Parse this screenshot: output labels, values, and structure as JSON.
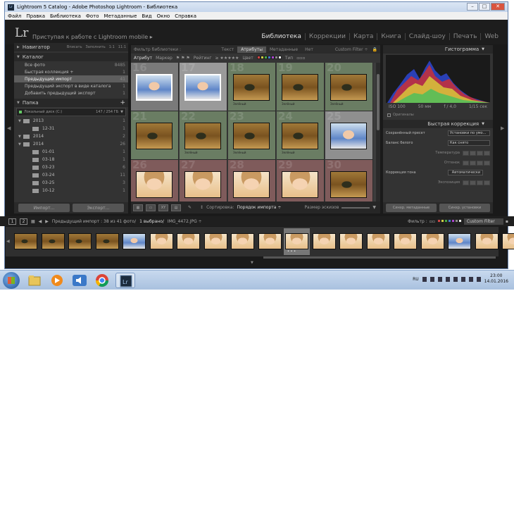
{
  "window": {
    "title": "Lightroom 5 Catalog - Adobe Photoshop Lightroom - Библиотека",
    "buttons": {
      "minimize": "–",
      "maximize": "□",
      "close": "✕"
    }
  },
  "menu": [
    "Файл",
    "Правка",
    "Библиотека",
    "Фото",
    "Метаданные",
    "Вид",
    "Окно",
    "Справка"
  ],
  "header": {
    "logo": "Lr",
    "mobile": "Приступая к работе с Lightroom mobile",
    "modules": [
      "Библиотека",
      "Коррекции",
      "Карта",
      "Книга",
      "Слайд-шоу",
      "Печать",
      "Web"
    ],
    "active_module": "Библиотека"
  },
  "left_panel": {
    "navigator": {
      "label": "Навигатор",
      "tools": [
        "Вписать",
        "Заполнить",
        "1:1",
        "11:1"
      ]
    },
    "catalog": {
      "label": "Каталог",
      "items": [
        {
          "label": "Все фото",
          "count": "8485"
        },
        {
          "label": "Быстрая коллекция +",
          "count": "1"
        },
        {
          "label": "Предыдущий импорт",
          "count": "41",
          "selected": true
        },
        {
          "label": "Предыдущий экспорт в виде каталога",
          "count": "1"
        },
        {
          "label": "Добавить предыдущий экспорт",
          "count": "1"
        }
      ]
    },
    "folders": {
      "label": "Папка",
      "add": "+",
      "disk": {
        "label": "Локальный диск (C:)",
        "space": "147 / 254 ГБ"
      },
      "items": [
        {
          "label": "2013",
          "count": "1",
          "level": 0
        },
        {
          "label": "12-31",
          "count": "1",
          "level": 1
        },
        {
          "label": "2014",
          "count": "2",
          "level": 0
        },
        {
          "label": "2014",
          "count": "26",
          "level": 0
        },
        {
          "label": "01-01",
          "count": "1",
          "level": 1
        },
        {
          "label": "03-18",
          "count": "1",
          "level": 1
        },
        {
          "label": "03-23",
          "count": "6",
          "level": 1
        },
        {
          "label": "03-24",
          "count": "11",
          "level": 1
        },
        {
          "label": "03-25",
          "count": "3",
          "level": 1
        },
        {
          "label": "10-12",
          "count": "1",
          "level": 1
        }
      ]
    },
    "buttons": {
      "import": "Импорт...",
      "export": "Экспорт..."
    }
  },
  "center": {
    "filter_label": "Фильтр библиотеки :",
    "filter_tabs": [
      "Текст",
      "Атрибуты",
      "Метаданные",
      "Нет"
    ],
    "active_filter_tab": "Атрибуты",
    "custom_filter": "Custom Filter ÷",
    "attr_bar": {
      "attr": "Атрибут",
      "flag": "Маркер",
      "rating": "Рейтинг",
      "color": "Цвет",
      "type": "Тип"
    },
    "color_swatches": [
      "#c44",
      "#cc4",
      "#4a4",
      "#47c",
      "#a4c",
      "#888",
      "#eee"
    ],
    "grid_cells": [
      {
        "num": "16",
        "bg": "#7a7a7a",
        "photo": "baby-blue",
        "label": ""
      },
      {
        "num": "17",
        "bg": "#9a9a9a",
        "photo": "baby-blue",
        "label": ""
      },
      {
        "num": "18",
        "bg": "#6a7d63",
        "photo": "warm",
        "label": "Зелёный"
      },
      {
        "num": "19",
        "bg": "#6a7d63",
        "photo": "warm",
        "label": "Зелёный"
      },
      {
        "num": "20",
        "bg": "#6a7d63",
        "photo": "warm",
        "label": "Зелёный"
      },
      {
        "num": "21",
        "bg": "#6a7d63",
        "photo": "warm",
        "label": ""
      },
      {
        "num": "22",
        "bg": "#6a7d63",
        "photo": "warm",
        "label": "Зелёный"
      },
      {
        "num": "23",
        "bg": "#6a7d63",
        "photo": "warm",
        "label": "Зелёный"
      },
      {
        "num": "24",
        "bg": "#6a7d63",
        "photo": "warm",
        "label": "Зелёный"
      },
      {
        "num": "25",
        "bg": "#8f8f8f",
        "photo": "baby-blue",
        "label": ""
      },
      {
        "num": "26",
        "bg": "#7f5b5b",
        "photo": "baby-face",
        "label": ""
      },
      {
        "num": "27",
        "bg": "#7f5b5b",
        "photo": "baby-face",
        "label": ""
      },
      {
        "num": "28",
        "bg": "#7f5b5b",
        "photo": "baby-face",
        "label": ""
      },
      {
        "num": "29",
        "bg": "#7f5b5b",
        "photo": "baby-face",
        "label": ""
      },
      {
        "num": "30",
        "bg": "#7f5b5b",
        "photo": "warm",
        "label": ""
      }
    ],
    "toolbar": {
      "sort_label": "Сортировка:",
      "sort_value": "Порядок импорта ÷",
      "thumb_size": "Размер эскизов"
    }
  },
  "right_panel": {
    "histogram": {
      "label": "Гистограмма",
      "iso": "ISO 100",
      "focal": "50 мм",
      "aperture": "f / 4,0",
      "shutter": "1/15 сек",
      "original": "Оригиналы"
    },
    "quick": {
      "label": "Быстрая коррекция",
      "preset_label": "Сохранённый пресет",
      "preset_value": "Установки по умо...",
      "wb_label": "Баланс белого",
      "wb_value": "Как снято",
      "temp_label": "Температура",
      "tint_label": "Оттенок",
      "tone_label": "Коррекция тона",
      "auto_label": "Автоматически",
      "exposure_label": "Экспозиция"
    },
    "buttons": {
      "sync_meta": "Синхр. метаданные",
      "sync_settings": "Синхр. установки"
    }
  },
  "filmstrip": {
    "page1": "1",
    "page2": "2",
    "path": "Предыдущий импорт : 38 из 41 фото/",
    "selected_count": "1 выбрано/",
    "selected_file": "IMG_4472.JPG ÷",
    "filter_label": "Фильтр :",
    "filter_value": "Custom Filter",
    "thumbs": [
      "warm",
      "warm",
      "warm",
      "warm",
      "baby-blue",
      "baby-face",
      "baby-face",
      "baby-face",
      "baby-face",
      "baby-face",
      "baby-face",
      "baby-face",
      "baby-face",
      "baby-face",
      "baby-face",
      "baby-face",
      "baby-blue",
      "baby-face",
      "baby-face"
    ],
    "selected_index": 10,
    "dots": "• • •"
  },
  "taskbar": {
    "lang": "RU",
    "time": "23:00",
    "date": "14.01.2016",
    "apps": [
      "explorer",
      "media-player",
      "volume-mixer",
      "chrome",
      "lightroom"
    ]
  }
}
